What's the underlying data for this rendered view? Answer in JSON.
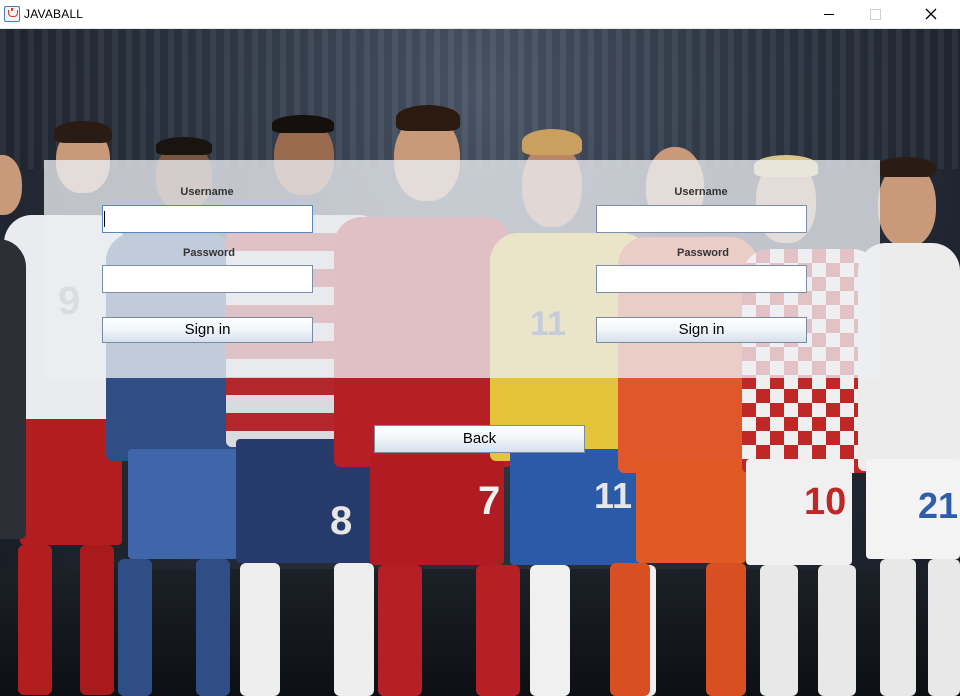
{
  "window": {
    "title": "JAVABALL",
    "app_icon": "java-cup-icon",
    "controls": [
      "minimize-icon",
      "maximize-icon",
      "close-icon"
    ]
  },
  "background": {
    "description_icon": "football-players-photo",
    "shirt_numbers": [
      "9",
      "8",
      "7",
      "11",
      "10",
      "21",
      "7",
      "11",
      "10"
    ]
  },
  "login_left": {
    "username_label": "Username",
    "username_value": "",
    "password_label": "Password",
    "password_value": "",
    "signin_label": "Sign in"
  },
  "login_right": {
    "username_label": "Username",
    "username_value": "",
    "password_label": "Password",
    "password_value": "",
    "signin_label": "Sign in"
  },
  "back_label": "Back",
  "colors": {
    "panel": "#eceef2",
    "field_border": "#7a8ea8",
    "button_gradient_bottom": "#d6e0ec"
  }
}
